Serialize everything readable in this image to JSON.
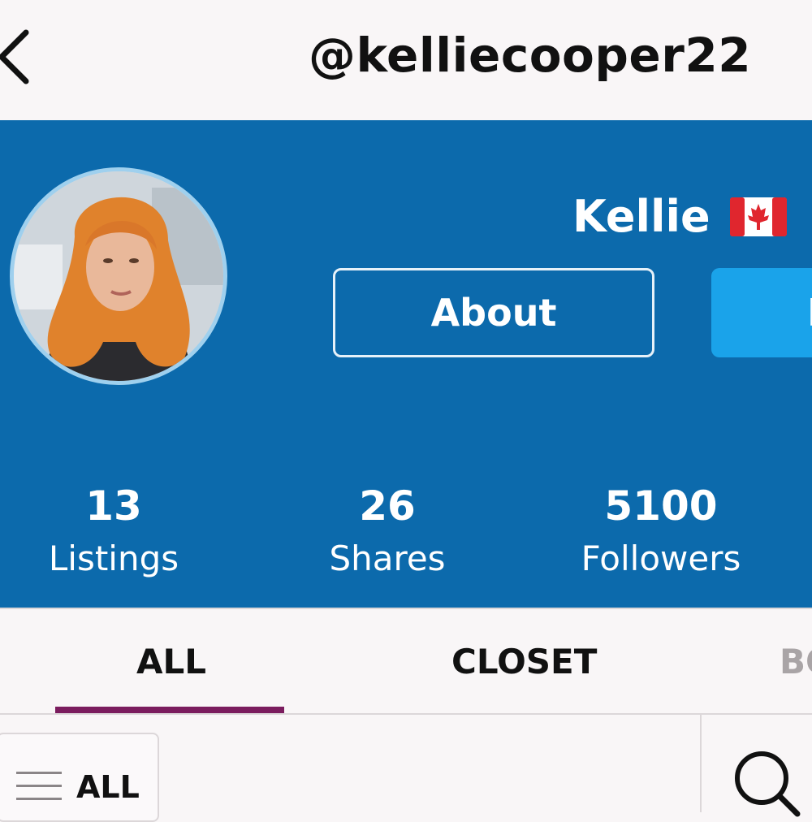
{
  "topbar": {
    "username": "@kelliecooper22",
    "back_icon": "chevron-left-icon"
  },
  "profile": {
    "display_name": "Kellie",
    "flag_icon": "canada-flag-icon",
    "about_label": "About",
    "follow_label": "F"
  },
  "stats": [
    {
      "value": "13",
      "label": "Listings"
    },
    {
      "value": "26",
      "label": "Shares"
    },
    {
      "value": "5100",
      "label": "Followers"
    }
  ],
  "tabs": [
    {
      "label": "ALL",
      "active": true
    },
    {
      "label": "CLOSET",
      "active": false
    },
    {
      "label": "BO",
      "active": false
    }
  ],
  "toolbar": {
    "filter_label": "ALL",
    "filter_icon": "hamburger-icon",
    "search_icon": "search-icon"
  },
  "colors": {
    "header_bg": "#0c6aac",
    "accent_button": "#1aa3ea",
    "tab_active_underline": "#7b1c5e"
  }
}
